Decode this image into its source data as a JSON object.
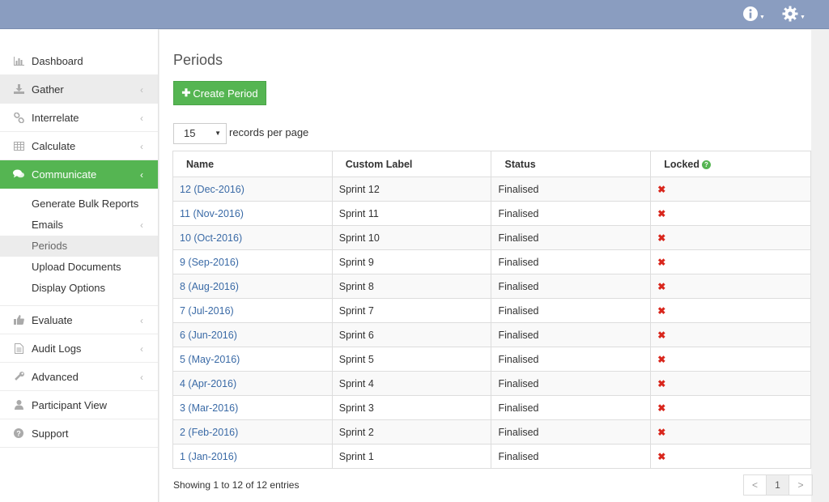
{
  "sidebar": {
    "items": [
      {
        "label": "Dashboard",
        "icon": "bar-chart-icon"
      },
      {
        "label": "Gather",
        "icon": "download-icon"
      },
      {
        "label": "Interrelate",
        "icon": "link-icon"
      },
      {
        "label": "Calculate",
        "icon": "table-icon"
      },
      {
        "label": "Communicate",
        "icon": "comments-icon"
      },
      {
        "label": "Evaluate",
        "icon": "thumbs-up-icon"
      },
      {
        "label": "Audit Logs",
        "icon": "document-icon"
      },
      {
        "label": "Advanced",
        "icon": "wrench-icon"
      },
      {
        "label": "Participant View",
        "icon": "user-icon"
      },
      {
        "label": "Support",
        "icon": "question-circle-icon"
      }
    ],
    "sub_items": [
      {
        "label": "Generate Bulk Reports"
      },
      {
        "label": "Emails"
      },
      {
        "label": "Periods"
      },
      {
        "label": "Upload Documents"
      },
      {
        "label": "Display Options"
      }
    ]
  },
  "main": {
    "title": "Periods",
    "create_button": "Create Period",
    "per_page_value": "15",
    "per_page_label": "records per page",
    "columns": [
      "Name",
      "Custom Label",
      "Status",
      "Locked"
    ],
    "rows": [
      {
        "name": "12 (Dec-2016)",
        "label": "Sprint 12",
        "status": "Finalised"
      },
      {
        "name": "11 (Nov-2016)",
        "label": "Sprint 11",
        "status": "Finalised"
      },
      {
        "name": "10 (Oct-2016)",
        "label": "Sprint 10",
        "status": "Finalised"
      },
      {
        "name": "9 (Sep-2016)",
        "label": "Sprint 9",
        "status": "Finalised"
      },
      {
        "name": "8 (Aug-2016)",
        "label": "Sprint 8",
        "status": "Finalised"
      },
      {
        "name": "7 (Jul-2016)",
        "label": "Sprint 7",
        "status": "Finalised"
      },
      {
        "name": "6 (Jun-2016)",
        "label": "Sprint 6",
        "status": "Finalised"
      },
      {
        "name": "5 (May-2016)",
        "label": "Sprint 5",
        "status": "Finalised"
      },
      {
        "name": "4 (Apr-2016)",
        "label": "Sprint 4",
        "status": "Finalised"
      },
      {
        "name": "3 (Mar-2016)",
        "label": "Sprint 3",
        "status": "Finalised"
      },
      {
        "name": "2 (Feb-2016)",
        "label": "Sprint 2",
        "status": "Finalised"
      },
      {
        "name": "1 (Jan-2016)",
        "label": "Sprint 1",
        "status": "Finalised"
      }
    ],
    "footer_info": "Showing 1 to 12 of 12 entries",
    "pagination": {
      "prev": "<",
      "page": "1",
      "next": ">"
    }
  },
  "colors": {
    "topbar": "#8a9dc0",
    "accent_green": "#55b552",
    "link_blue": "#3a6aa6",
    "unlocked_red": "#d9261c"
  }
}
